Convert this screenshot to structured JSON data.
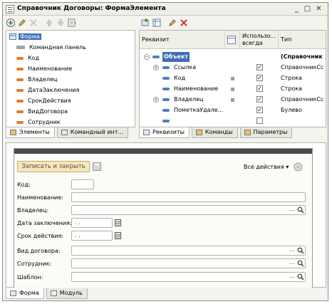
{
  "window": {
    "title": "Справочник Договоры: ФормаЭлемента"
  },
  "elements_tree": {
    "root": "Форма",
    "items": [
      "Командная панель",
      "Код",
      "Наименование",
      "Владелец",
      "ДатаЗаключения",
      "СрокДействия",
      "ВидДоговора",
      "Сотрудник"
    ]
  },
  "left_tabs": [
    "Элементы",
    "Командный инт..."
  ],
  "attributes": {
    "headers": {
      "attr": "Реквизит",
      "used": "Использо... всегда",
      "type": "Тип"
    },
    "rows": [
      {
        "name": "Объект",
        "type": "(Справочник"
      },
      {
        "name": "Ссылка",
        "type": "СправочникСс"
      },
      {
        "name": "Код",
        "type": "Строка"
      },
      {
        "name": "Наименование",
        "type": "Строка"
      },
      {
        "name": "Владелец",
        "type": "СправочникСс"
      },
      {
        "name": "ПометкаУдале...",
        "type": "Булево"
      }
    ]
  },
  "right_tabs": [
    "Реквизиты",
    "Команды",
    "Параметры"
  ],
  "form": {
    "save_button": "Записать и закрыть",
    "all_actions": "Все действия",
    "fields": {
      "code": "Код:",
      "name": "Наименование:",
      "owner": "Владелец:",
      "date": "Дата заключения:",
      "date_value": ". .",
      "term": "Срок действия:",
      "term_value": ". .",
      "kind": "Вид договора:",
      "employee": "Сотрудник:",
      "template": "Шаблон:"
    }
  },
  "bottom_tabs": [
    "Форма",
    "Модуль"
  ]
}
